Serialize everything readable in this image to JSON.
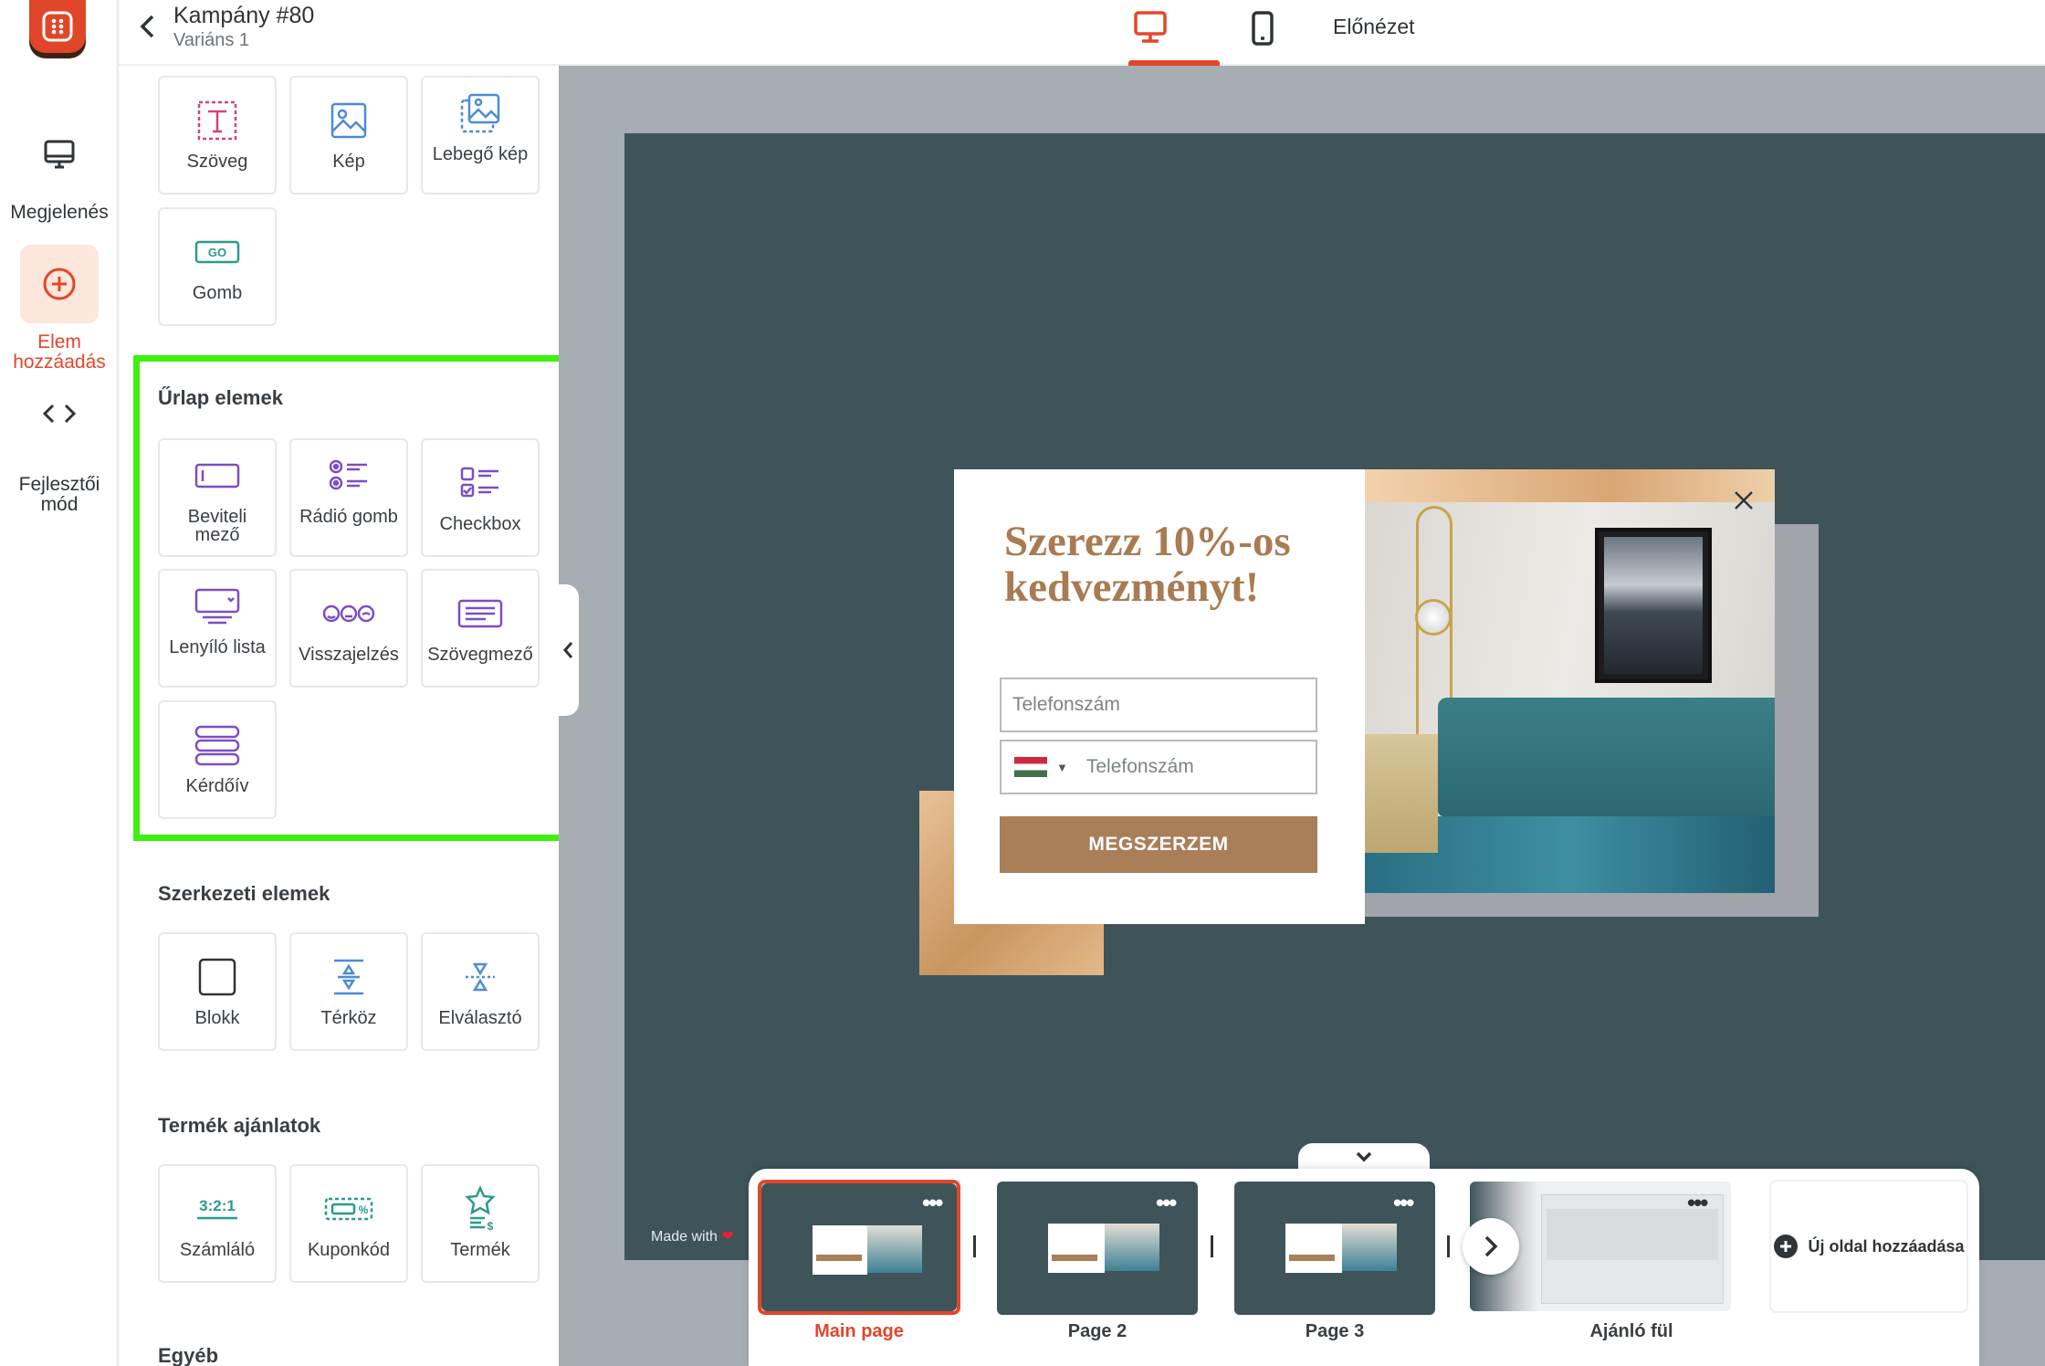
{
  "rail": {
    "items": [
      {
        "label": "Megjelenés",
        "icon": "monitor-icon"
      },
      {
        "label": "Elem hozzáadás",
        "icon": "plus-circle-icon"
      },
      {
        "label": "Fejlesztői mód",
        "icon": "code-icon"
      }
    ]
  },
  "header": {
    "title": "Kampány #80",
    "subtitle": "Variáns 1",
    "preview_label": "Előnézet"
  },
  "panel": {
    "basic": [
      "Szöveg",
      "Kép",
      "Lebegő kép",
      "Gomb"
    ],
    "form_title": "Űrlap elemek",
    "form": [
      "Beviteli mező",
      "Rádió gomb",
      "Checkbox",
      "Lenyíló lista",
      "Visszajelzés",
      "Szövegmező",
      "Kérdőív"
    ],
    "structure_title": "Szerkezeti elemek",
    "structure": [
      "Blokk",
      "Térköz",
      "Elválasztó"
    ],
    "products_title": "Termék ajánlatok",
    "products": [
      "Számláló",
      "Kuponkód",
      "Termék"
    ],
    "other_title": "Egyéb"
  },
  "popup": {
    "headline": "Szerezz 10%-os kedvezményt!",
    "phone_placeholder": "Telefonszám",
    "phone2_placeholder": "Telefonszám",
    "cta": "MEGSZERZEM"
  },
  "made_with": "Made with",
  "pages": {
    "items": [
      "Main page",
      "Page 2",
      "Page 3",
      "Ajánló fül"
    ],
    "add_label": "Új oldal hozzáadása"
  },
  "colors": {
    "accent": "#e2462a",
    "highlight": "#3df10e",
    "stage": "#3e5459",
    "cta": "#a97e59"
  }
}
